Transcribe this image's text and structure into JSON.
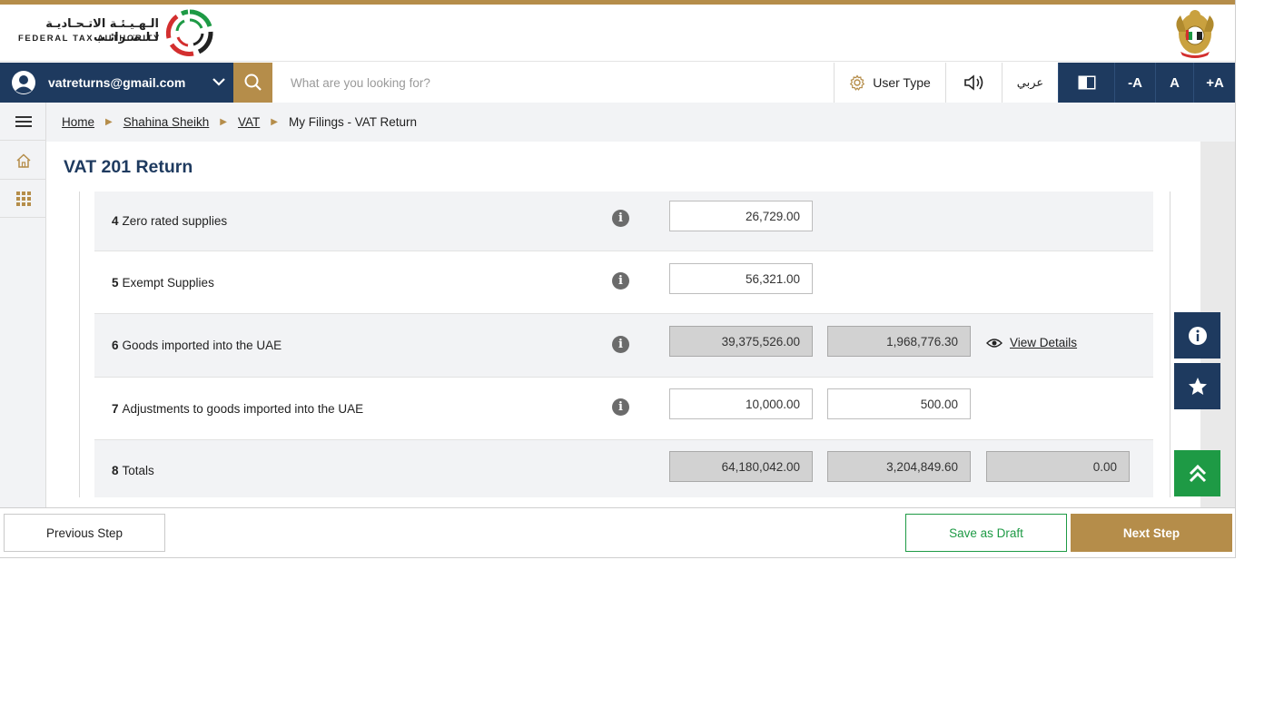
{
  "header": {
    "logo_ar": "الـهـيـئـة الاتـحـاديـة لـلـضـرائـب",
    "logo_en": "FEDERAL TAX AUTHORITY"
  },
  "navbar": {
    "account_email": "vatreturns@gmail.com",
    "search_placeholder": "What are you looking for?",
    "user_type_label": "User Type",
    "language_label": "عربي",
    "font_decrease": "-A",
    "font_normal": "A",
    "font_increase": "+A"
  },
  "breadcrumb": {
    "items": [
      "Home",
      "Shahina Sheikh",
      "VAT"
    ],
    "current": "My Filings - VAT Return"
  },
  "page": {
    "title": "VAT 201 Return"
  },
  "rows": [
    {
      "num": "4",
      "label": "Zero rated supplies",
      "amount": "26,729.00"
    },
    {
      "num": "5",
      "label": "Exempt Supplies",
      "amount": "56,321.00"
    },
    {
      "num": "6",
      "label": "Goods imported into the UAE",
      "amount": "39,375,526.00",
      "vat": "1,968,776.30",
      "link": "View Details"
    },
    {
      "num": "7",
      "label": "Adjustments to goods imported into the UAE",
      "amount": "10,000.00",
      "vat": "500.00"
    },
    {
      "num": "8",
      "label": "Totals",
      "amount": "64,180,042.00",
      "vat": "3,204,849.60",
      "adjust": "0.00"
    }
  ],
  "footer": {
    "previous": "Previous Step",
    "draft": "Save as Draft",
    "next": "Next Step"
  },
  "colors": {
    "navy": "#1e3a5f",
    "gold": "#b58d4a",
    "green": "#1e9a45"
  },
  "icons": [
    "user-avatar-icon",
    "chevron-down-icon",
    "search-icon",
    "gear-icon",
    "speaker-icon",
    "contrast-icon",
    "menu-icon",
    "home-icon",
    "grid-icon",
    "info-icon",
    "eye-icon",
    "star-icon",
    "double-chevron-up-icon"
  ]
}
